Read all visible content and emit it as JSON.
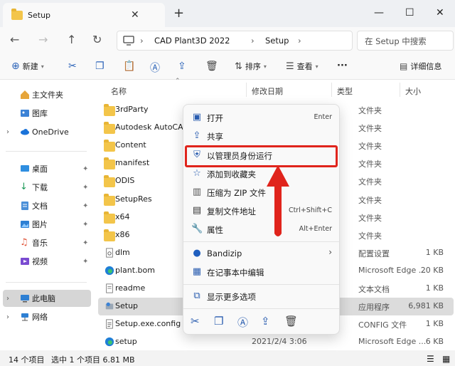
{
  "window": {
    "tab_title": "Setup",
    "new_tab": "+",
    "close_tab": "✕",
    "minimize": "—",
    "maximize": "☐",
    "close": "✕"
  },
  "nav": {
    "breadcrumb": [
      "CAD Plant3D 2022",
      "Setup"
    ],
    "search_placeholder": "在 Setup 中搜索"
  },
  "toolbar": {
    "new_label": "新建",
    "sort_label": "排序",
    "view_label": "查看",
    "more_label": "···",
    "details_label": "详细信息"
  },
  "sidebar": {
    "items": [
      {
        "label": "主文件夹",
        "icon": "home-icon",
        "caret": false,
        "pin": false
      },
      {
        "label": "图库",
        "icon": "gallery-icon",
        "caret": false,
        "pin": false
      },
      {
        "label": "OneDrive",
        "icon": "cloud-icon",
        "caret": true,
        "pin": false
      },
      {
        "label": "桌面",
        "icon": "desktop-icon",
        "caret": false,
        "pin": true
      },
      {
        "label": "下载",
        "icon": "download-icon",
        "caret": false,
        "pin": true
      },
      {
        "label": "文档",
        "icon": "document-icon",
        "caret": false,
        "pin": true
      },
      {
        "label": "图片",
        "icon": "picture-icon",
        "caret": false,
        "pin": true
      },
      {
        "label": "音乐",
        "icon": "music-icon",
        "caret": false,
        "pin": true
      },
      {
        "label": "视频",
        "icon": "video-icon",
        "caret": false,
        "pin": true
      },
      {
        "label": "此电脑",
        "icon": "pc-icon",
        "caret": true,
        "pin": false
      },
      {
        "label": "网络",
        "icon": "network-icon",
        "caret": true,
        "pin": false
      }
    ]
  },
  "columns": {
    "name": "名称",
    "date": "修改日期",
    "type": "类型",
    "size": "大小"
  },
  "files": [
    {
      "name": "3rdParty",
      "kind": "folder",
      "date": "",
      "type": "文件夹",
      "size": ""
    },
    {
      "name": "Autodesk AutoCAD",
      "kind": "folder",
      "date": "",
      "type": "文件夹",
      "size": ""
    },
    {
      "name": "Content",
      "kind": "folder",
      "date": "",
      "type": "文件夹",
      "size": ""
    },
    {
      "name": "manifest",
      "kind": "folder",
      "date": "",
      "type": "文件夹",
      "size": ""
    },
    {
      "name": "ODIS",
      "kind": "folder",
      "date": "",
      "type": "文件夹",
      "size": ""
    },
    {
      "name": "SetupRes",
      "kind": "folder",
      "date": "",
      "type": "文件夹",
      "size": ""
    },
    {
      "name": "x64",
      "kind": "folder",
      "date": "",
      "type": "文件夹",
      "size": ""
    },
    {
      "name": "x86",
      "kind": "folder",
      "date": "",
      "type": "文件夹",
      "size": ""
    },
    {
      "name": "dlm",
      "kind": "settings",
      "date": "",
      "type": "配置设置",
      "size": "1 KB"
    },
    {
      "name": "plant.bom",
      "kind": "edge",
      "date": "",
      "type": "Microsoft Edge ...",
      "size": "20 KB"
    },
    {
      "name": "readme",
      "kind": "text",
      "date": "",
      "type": "文本文档",
      "size": "1 KB"
    },
    {
      "name": "Setup",
      "kind": "setup",
      "date": "",
      "type": "应用程序",
      "size": "6,981 KB"
    },
    {
      "name": "Setup.exe.config",
      "kind": "config",
      "date": "",
      "type": "CONFIG 文件",
      "size": "1 KB"
    },
    {
      "name": "setup",
      "kind": "edge",
      "date": "2021/2/4 3:06",
      "type": "Microsoft Edge ...",
      "size": "6 KB"
    }
  ],
  "context_menu": {
    "items": [
      {
        "label": "打开",
        "shortcut": "Enter",
        "icon": "open-icon"
      },
      {
        "label": "共享",
        "shortcut": "",
        "icon": "share-icon"
      },
      {
        "label": "以管理员身份运行",
        "shortcut": "",
        "icon": "shield-icon"
      },
      {
        "label": "添加到收藏夹",
        "shortcut": "",
        "icon": "star-icon"
      },
      {
        "label": "压缩为 ZIP 文件",
        "shortcut": "",
        "icon": "zip-icon"
      },
      {
        "label": "复制文件地址",
        "shortcut": "Ctrl+Shift+C",
        "icon": "copy-path-icon"
      },
      {
        "label": "属性",
        "shortcut": "Alt+Enter",
        "icon": "wrench-icon"
      },
      {
        "label": "Bandizip",
        "shortcut": "",
        "icon": "bandizip-icon"
      },
      {
        "label": "在记事本中编辑",
        "shortcut": "",
        "icon": "notepad-icon"
      },
      {
        "label": "显示更多选项",
        "shortcut": "",
        "icon": "more-options-icon"
      }
    ]
  },
  "status": {
    "count": "14 个项目",
    "selected": "选中 1 个项目  6.81 MB"
  },
  "colors": {
    "accent": "#2a5db0",
    "highlight": "#e0241c",
    "folder": "#f3c54a"
  }
}
